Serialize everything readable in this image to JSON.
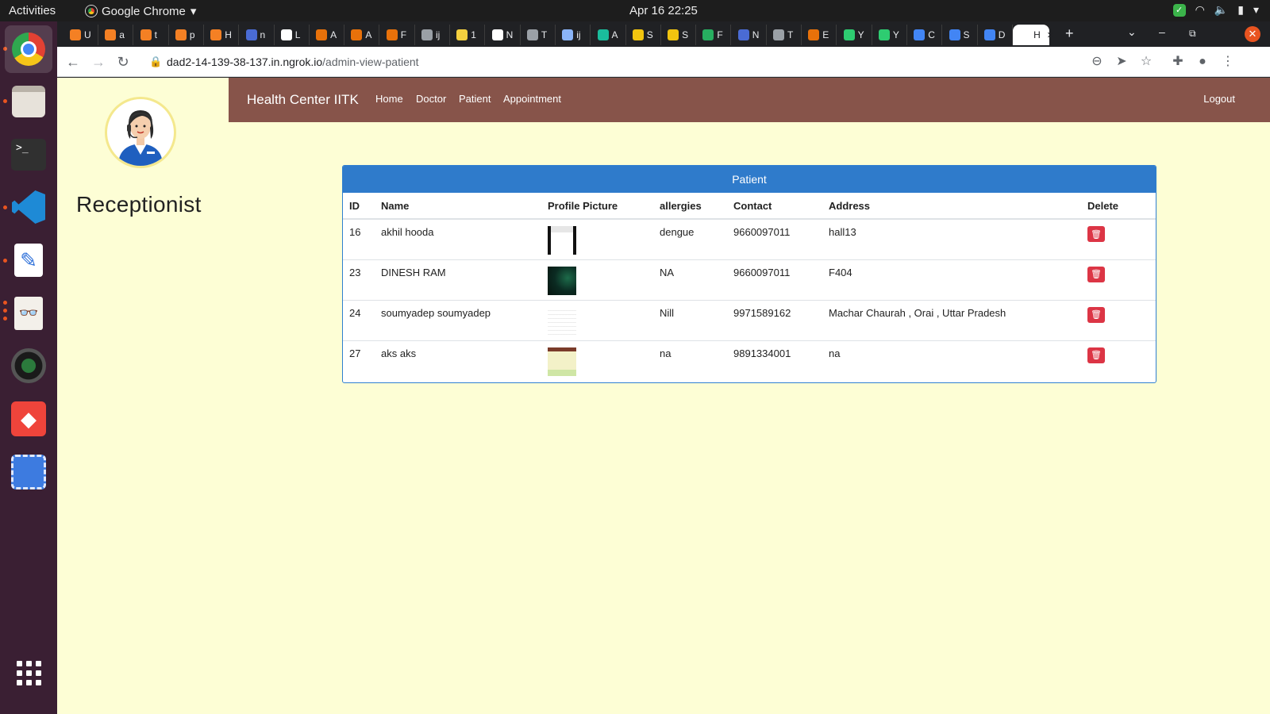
{
  "system": {
    "activities": "Activities",
    "app_name": "Google Chrome",
    "clock": "Apr 16  22:25"
  },
  "browser": {
    "tabs": [
      {
        "title": "U",
        "icon": "stackoverflow-icon",
        "color": "#f48024"
      },
      {
        "title": "a",
        "icon": "stackoverflow-icon",
        "color": "#f48024"
      },
      {
        "title": "t",
        "icon": "stackoverflow-icon",
        "color": "#f48024"
      },
      {
        "title": "p",
        "icon": "stackoverflow-icon",
        "color": "#f48024"
      },
      {
        "title": "H",
        "icon": "stackoverflow-icon",
        "color": "#f48024"
      },
      {
        "title": "n",
        "icon": "graduation-cap-icon",
        "color": "#4a6bd4"
      },
      {
        "title": "L",
        "icon": "igi-icon",
        "color": "#ffffff"
      },
      {
        "title": "A",
        "icon": "letter-e-icon",
        "color": "#e8710a"
      },
      {
        "title": "A",
        "icon": "letter-e-icon",
        "color": "#e8710a"
      },
      {
        "title": "F",
        "icon": "letter-e-icon",
        "color": "#e8710a"
      },
      {
        "title": "ij",
        "icon": "globe-icon",
        "color": "#9aa0a6"
      },
      {
        "title": "1",
        "icon": "smiley-icon",
        "color": "#f4d03f"
      },
      {
        "title": "N",
        "icon": "pkp-icon",
        "color": "#ffffff"
      },
      {
        "title": "T",
        "icon": "globe-icon",
        "color": "#9aa0a6"
      },
      {
        "title": "ij",
        "icon": "table-icon",
        "color": "#8ab4f8"
      },
      {
        "title": "A",
        "icon": "r-icon",
        "color": "#1abc9c"
      },
      {
        "title": "S",
        "icon": "pattern-icon",
        "color": "#f1c40f"
      },
      {
        "title": "S",
        "icon": "pattern-icon",
        "color": "#f1c40f"
      },
      {
        "title": "F",
        "icon": "plus-cross-icon",
        "color": "#27ae60"
      },
      {
        "title": "N",
        "icon": "graduation-cap-icon",
        "color": "#4a6bd4"
      },
      {
        "title": "T",
        "icon": "globe-icon",
        "color": "#9aa0a6"
      },
      {
        "title": "E",
        "icon": "letter-e-icon",
        "color": "#e8710a"
      },
      {
        "title": "Y",
        "icon": "leaf-icon",
        "color": "#2ecc71"
      },
      {
        "title": "Y",
        "icon": "leaf-icon",
        "color": "#2ecc71"
      },
      {
        "title": "C",
        "icon": "docs-icon",
        "color": "#4285f4"
      },
      {
        "title": "S",
        "icon": "docs-icon",
        "color": "#4285f4"
      },
      {
        "title": "D",
        "icon": "docs-icon",
        "color": "#4285f4"
      },
      {
        "title": "H",
        "icon": "page-icon",
        "color": "#ffffff",
        "active": true
      }
    ],
    "url_host": "dad2-14-139-38-137.in.ngrok.io",
    "url_path": "/admin-view-patient"
  },
  "page": {
    "role": "Receptionist",
    "brand": "Health Center IITK",
    "nav": [
      "Home",
      "Doctor",
      "Patient",
      "Appointment"
    ],
    "logout": "Logout",
    "panel_title": "Patient",
    "columns": [
      "ID",
      "Name",
      "Profile Picture",
      "allergies",
      "Contact",
      "Address",
      "Delete"
    ],
    "patients": [
      {
        "id": "16",
        "name": "akhil hooda",
        "allergies": "dengue",
        "contact": "9660097011",
        "address": "hall13",
        "thumb": "document-scan"
      },
      {
        "id": "23",
        "name": "DINESH RAM",
        "allergies": "NA",
        "contact": "9660097011",
        "address": "F404",
        "thumb": "dark-green"
      },
      {
        "id": "24",
        "name": "soumyadep soumyadep",
        "allergies": "Nill",
        "contact": "9971589162",
        "address": "Machar Chaurah , Orai , Uttar Pradesh",
        "thumb": "blank-document"
      },
      {
        "id": "27",
        "name": "aks aks",
        "allergies": "na",
        "contact": "9891334001",
        "address": "na",
        "thumb": "screenshot"
      }
    ]
  },
  "colors": {
    "navbar": "#87544a",
    "panel_header": "#2f7bcb",
    "page_bg": "#fdfed5",
    "delete": "#dc3545"
  }
}
